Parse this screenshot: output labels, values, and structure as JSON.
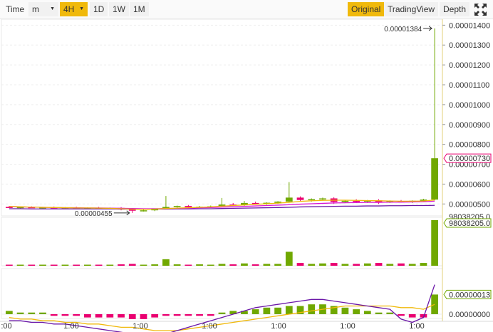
{
  "toolbar": {
    "time_label": "Time",
    "minute_select": "m",
    "interval_4h": "4H",
    "interval_1d": "1D",
    "interval_1w": "1W",
    "interval_1m": "1M",
    "view_original": "Original",
    "view_tradingview": "TradingView",
    "view_depth": "Depth"
  },
  "price_axis": {
    "ticks": [
      "0.00001400",
      "0.00001300",
      "0.00001200",
      "0.00001100",
      "0.00001000",
      "0.00000900",
      "0.00000800",
      "0.00000700",
      "0.00000600",
      "0.00000500"
    ],
    "current_price": "0.00000730",
    "high_label": "0.00001384",
    "low_label": "0.00000455",
    "overlap_label": "98038205.0"
  },
  "volume_axis": {
    "current": "98038205.0"
  },
  "macd_axis": {
    "current": "0.00000013",
    "zero": "0.00000000"
  },
  "time_axis": {
    "labels": [
      ":00",
      "1:00",
      "1:00",
      "1:00",
      "1:00",
      "1:00",
      "1:00"
    ]
  },
  "colors": {
    "up": "#70a800",
    "down": "#ea0070",
    "accent": "#f0b90b",
    "ma_yellow": "#f0b90b",
    "ma_purple": "#6b17a8",
    "ma_pink": "#d916d4"
  },
  "chart_data": {
    "type": "candlestick",
    "candles": [
      {
        "o": 485,
        "h": 490,
        "l": 480,
        "c": 482
      },
      {
        "o": 482,
        "h": 486,
        "l": 478,
        "c": 484
      },
      {
        "o": 484,
        "h": 488,
        "l": 480,
        "c": 481
      },
      {
        "o": 481,
        "h": 485,
        "l": 477,
        "c": 483
      },
      {
        "o": 483,
        "h": 487,
        "l": 479,
        "c": 480
      },
      {
        "o": 480,
        "h": 484,
        "l": 476,
        "c": 482
      },
      {
        "o": 482,
        "h": 486,
        "l": 478,
        "c": 479
      },
      {
        "o": 479,
        "h": 483,
        "l": 475,
        "c": 481
      },
      {
        "o": 481,
        "h": 485,
        "l": 477,
        "c": 478
      },
      {
        "o": 478,
        "h": 482,
        "l": 474,
        "c": 480
      },
      {
        "o": 480,
        "h": 484,
        "l": 468,
        "c": 472
      },
      {
        "o": 472,
        "h": 478,
        "l": 455,
        "c": 466
      },
      {
        "o": 466,
        "h": 472,
        "l": 462,
        "c": 468
      },
      {
        "o": 468,
        "h": 475,
        "l": 464,
        "c": 478
      },
      {
        "o": 478,
        "h": 540,
        "l": 474,
        "c": 485
      },
      {
        "o": 485,
        "h": 492,
        "l": 480,
        "c": 490
      },
      {
        "o": 490,
        "h": 495,
        "l": 482,
        "c": 484
      },
      {
        "o": 484,
        "h": 490,
        "l": 480,
        "c": 486
      },
      {
        "o": 486,
        "h": 492,
        "l": 482,
        "c": 488
      },
      {
        "o": 488,
        "h": 530,
        "l": 485,
        "c": 497
      },
      {
        "o": 497,
        "h": 505,
        "l": 492,
        "c": 494
      },
      {
        "o": 494,
        "h": 515,
        "l": 490,
        "c": 505
      },
      {
        "o": 505,
        "h": 512,
        "l": 498,
        "c": 500
      },
      {
        "o": 500,
        "h": 508,
        "l": 496,
        "c": 506
      },
      {
        "o": 506,
        "h": 514,
        "l": 500,
        "c": 512
      },
      {
        "o": 512,
        "h": 610,
        "l": 508,
        "c": 532
      },
      {
        "o": 532,
        "h": 538,
        "l": 515,
        "c": 520
      },
      {
        "o": 520,
        "h": 528,
        "l": 512,
        "c": 524
      },
      {
        "o": 524,
        "h": 532,
        "l": 518,
        "c": 528
      },
      {
        "o": 528,
        "h": 534,
        "l": 500,
        "c": 510
      },
      {
        "o": 510,
        "h": 520,
        "l": 505,
        "c": 516
      },
      {
        "o": 516,
        "h": 524,
        "l": 508,
        "c": 512
      },
      {
        "o": 512,
        "h": 520,
        "l": 505,
        "c": 518
      },
      {
        "o": 518,
        "h": 524,
        "l": 500,
        "c": 508
      },
      {
        "o": 508,
        "h": 518,
        "l": 505,
        "c": 514
      },
      {
        "o": 514,
        "h": 520,
        "l": 508,
        "c": 510
      },
      {
        "o": 510,
        "h": 518,
        "l": 505,
        "c": 516
      },
      {
        "o": 516,
        "h": 526,
        "l": 510,
        "c": 522
      },
      {
        "o": 522,
        "h": 1384,
        "l": 518,
        "c": 730
      }
    ],
    "volume": [
      2,
      1,
      2,
      1,
      2,
      1,
      2,
      1,
      2,
      1,
      3,
      4,
      2,
      3,
      14,
      3,
      2,
      3,
      2,
      4,
      3,
      5,
      3,
      4,
      4,
      30,
      6,
      4,
      5,
      6,
      4,
      4,
      5,
      6,
      4,
      5,
      4,
      6,
      98
    ],
    "ma_yellow": [
      488,
      486,
      484,
      483,
      482,
      481,
      480,
      480,
      479,
      478,
      476,
      474,
      473,
      474,
      477,
      479,
      481,
      483,
      485,
      489,
      492,
      495,
      498,
      501,
      504,
      508,
      513,
      516,
      518,
      519,
      519,
      518,
      517,
      516,
      515,
      514,
      514,
      515,
      520
    ],
    "ma_pink": [
      486,
      485,
      484,
      483,
      482,
      481,
      481,
      480,
      480,
      479,
      478,
      477,
      476,
      476,
      477,
      478,
      479,
      481,
      482,
      484,
      486,
      488,
      490,
      492,
      494,
      496,
      499,
      501,
      503,
      505,
      506,
      507,
      508,
      508,
      509,
      509,
      510,
      511,
      514
    ],
    "ma_purple": [
      476,
      476,
      475,
      475,
      475,
      475,
      475,
      475,
      475,
      475,
      474,
      474,
      474,
      474,
      474,
      475,
      475,
      476,
      476,
      477,
      478,
      479,
      480,
      481,
      482,
      483,
      485,
      486,
      487,
      488,
      489,
      489,
      490,
      490,
      491,
      491,
      492,
      492,
      493
    ],
    "macd_hist": [
      2,
      1,
      1,
      1,
      -1,
      -1,
      -1,
      -2,
      -2,
      -2,
      -2,
      -3,
      -3,
      -2,
      -1,
      -1,
      -1,
      -1,
      -1,
      1,
      2,
      2,
      3,
      4,
      4,
      5,
      5,
      6,
      6,
      5,
      4,
      3,
      2,
      1,
      1,
      -1,
      -2,
      -2,
      12
    ],
    "macd_dif": [
      -4,
      -4,
      -5,
      -5,
      -6,
      -6,
      -7,
      -8,
      -9,
      -10,
      -11,
      -12,
      -13,
      -13,
      -12,
      -10,
      -8,
      -6,
      -4,
      -2,
      0,
      2,
      4,
      5,
      6,
      7,
      8,
      9,
      9,
      8,
      7,
      6,
      5,
      4,
      3,
      -3,
      -5,
      -2,
      18
    ],
    "macd_dea": [
      -2,
      -3,
      -3,
      -4,
      -4,
      -5,
      -5,
      -6,
      -6,
      -7,
      -8,
      -8,
      -9,
      -10,
      -10,
      -10,
      -9,
      -8,
      -7,
      -6,
      -5,
      -4,
      -3,
      -2,
      -1,
      0,
      1,
      2,
      3,
      4,
      5,
      5,
      5,
      5,
      5,
      4,
      4,
      3,
      6
    ],
    "price_range": [
      440,
      1430
    ]
  }
}
